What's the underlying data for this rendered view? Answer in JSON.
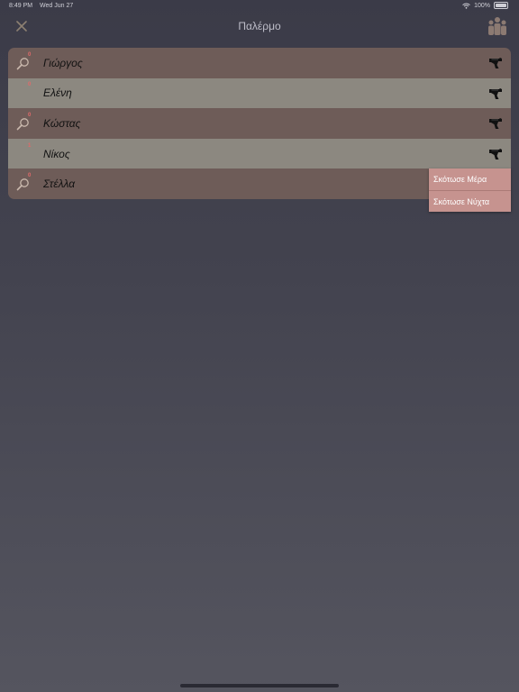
{
  "status": {
    "time": "8:49 PM",
    "date": "Wed Jun 27",
    "battery": "100%"
  },
  "nav": {
    "title": "Παλέρμο"
  },
  "players": [
    {
      "name": "Γιώργος",
      "badge": "0",
      "icon": "search-icon"
    },
    {
      "name": "Ελένη",
      "badge": "0",
      "icon": ""
    },
    {
      "name": "Κώστας",
      "badge": "0",
      "icon": "search-icon"
    },
    {
      "name": "Νίκος",
      "badge": "1",
      "icon": ""
    },
    {
      "name": "Στέλλα",
      "badge": "0",
      "icon": "search-icon"
    }
  ],
  "menu": {
    "kill_day": "Σκότωσε Μέρα",
    "kill_night": "Σκότωσε Νύχτα"
  },
  "colors": {
    "row_dark": "#6e5c58",
    "row_light": "#8c8880",
    "menu": "#c6938f",
    "badge": "#e06a6a"
  }
}
